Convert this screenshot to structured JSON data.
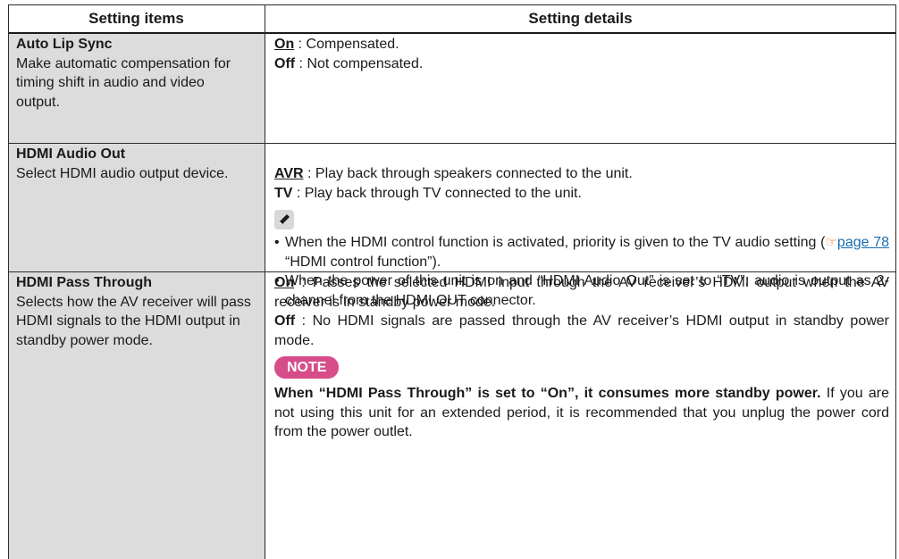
{
  "headers": {
    "items": "Setting items",
    "details": "Setting details"
  },
  "rows": [
    {
      "title": "Auto Lip Sync",
      "desc": "Make automatic compensation for timing shift in audio and video output.",
      "opts": [
        {
          "key": "On",
          "text": " : Compensated."
        },
        {
          "key": "Off",
          "text": " : Not compensated."
        }
      ]
    },
    {
      "title": "HDMI Audio Out",
      "desc": "Select HDMI audio output device.",
      "opts": [
        {
          "key": "AVR",
          "text": " : Play back through speakers connected to the unit."
        },
        {
          "key": "TV",
          "text": " : Play back through TV connected to the unit."
        }
      ],
      "notes": {
        "b1_part1": "When the HDMI control function is activated, priority is given to the TV audio setting (",
        "b1_link": "page 78",
        "b1_part2": " “HDMI control function”).",
        "b2": "When the power of this unit is on and “HDMI Audio Out” is set to “TV”, audio is output as 2-channel from the HDMI OUT connector."
      }
    },
    {
      "title": "HDMI Pass Through",
      "desc": "Selects how the AV receiver will pass HDMI signals to the HDMI output in standby power mode.",
      "opts": [
        {
          "key": "On",
          "text": " : Passes the selected HDMI input through the AV receiver’s HDMI output when the AV receiver is in standby power mode."
        },
        {
          "key": "Off",
          "text": " : No HDMI signals are passed through the AV receiver’s HDMI output in standby power mode."
        }
      ],
      "note_label": "NOTE",
      "note_bold": "When “HDMI Pass Through” is set to “On”, it consumes more standby power.",
      "note_rest": " If you are not using this unit for an extended period, it is recommended that you unplug the power cord from the power outlet."
    }
  ],
  "colors": {
    "label_bg": "#dcdcdc",
    "note_badge": "#d64d8a",
    "link": "#1a6db0",
    "link_glyph": "#e0701e"
  }
}
